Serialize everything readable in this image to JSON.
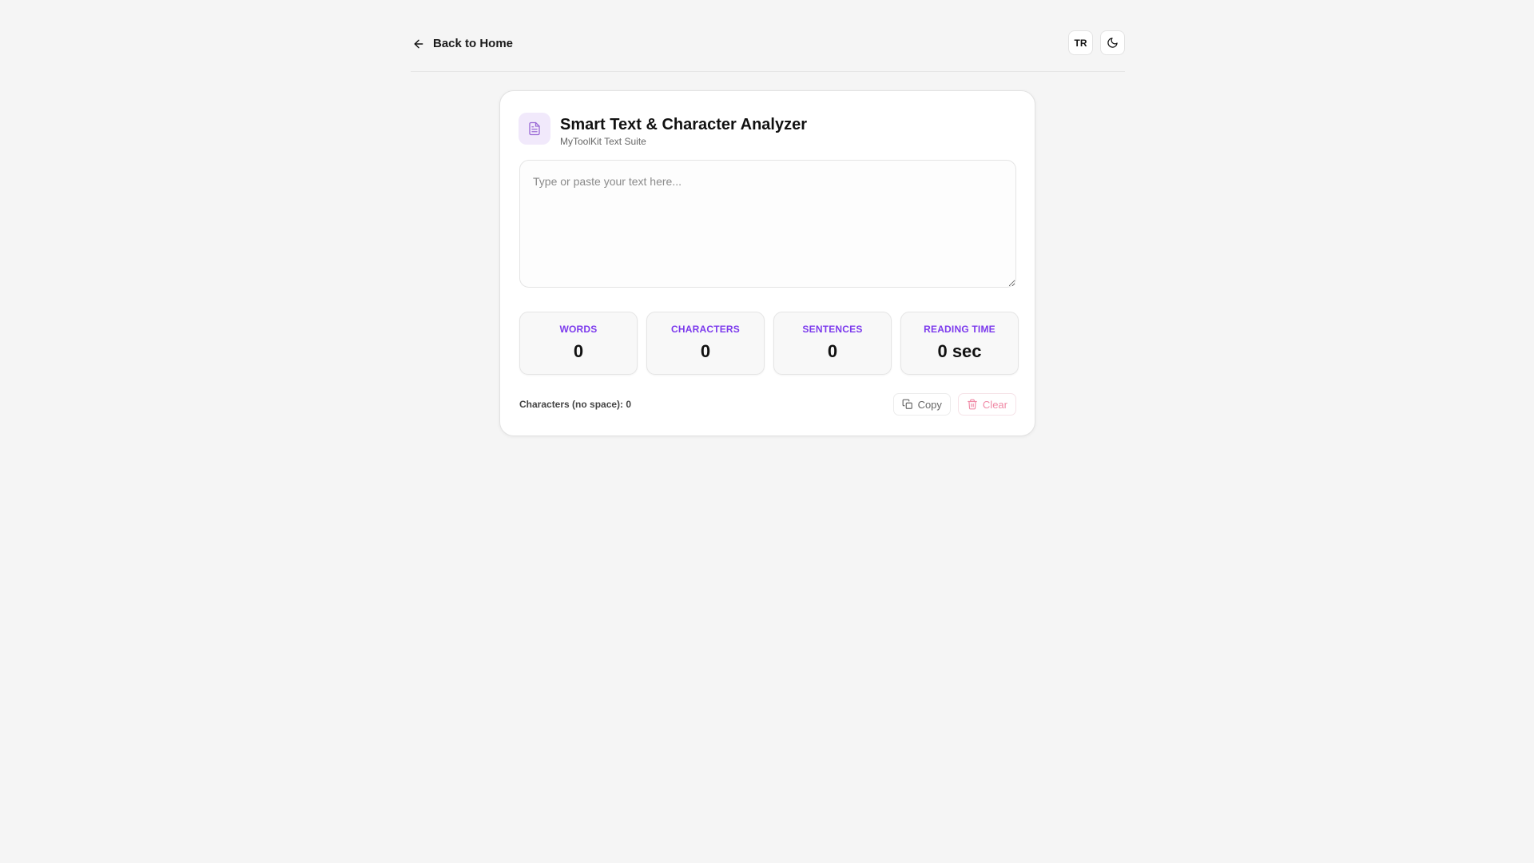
{
  "nav": {
    "back_label": "Back to Home",
    "lang_label": "TR"
  },
  "tool": {
    "title": "Smart Text & Character Analyzer",
    "subtitle": "MyToolKit Text Suite"
  },
  "editor": {
    "placeholder": "Type or paste your text here...",
    "value": ""
  },
  "stats": [
    {
      "label": "WORDS",
      "value": "0"
    },
    {
      "label": "CHARACTERS",
      "value": "0"
    },
    {
      "label": "SENTENCES",
      "value": "0"
    },
    {
      "label": "READING TIME",
      "value": "0 sec"
    }
  ],
  "footer": {
    "nospace": "Characters (no space): 0",
    "copy_label": "Copy",
    "clear_label": "Clear"
  },
  "colors": {
    "accent": "#7c3aed",
    "clear": "#f08aa6",
    "background": "#f5f5f5"
  }
}
